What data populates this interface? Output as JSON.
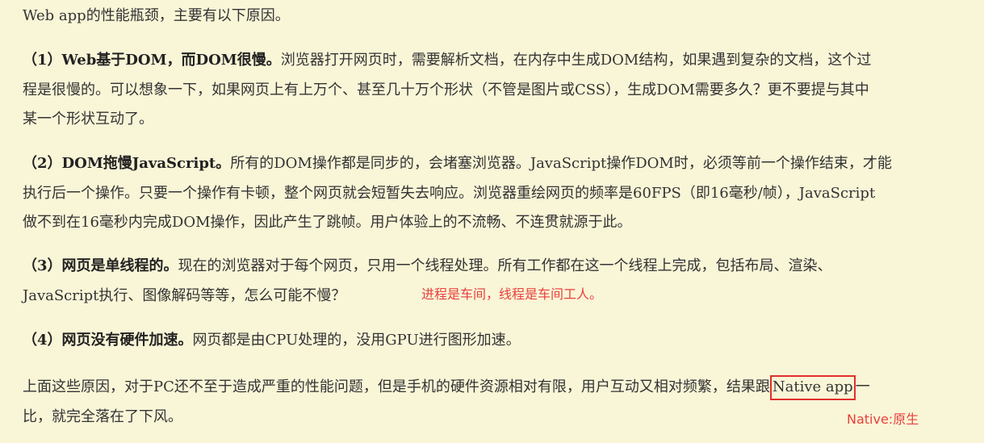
{
  "intro": "Web app的性能瓶颈，主要有以下原因。",
  "p1": {
    "heading": "（1）Web基于DOM，而DOM很慢。",
    "line1": "浏览器打开网页时，需要解析文档，在内存中生成DOM结构，如果遇到复杂的文档，这个过",
    "line2": "程是很慢的。可以想象一下，如果网页上有上万个、甚至几十万个形状（不管是图片或CSS），生成DOM需要多久？更不要提与其中",
    "line3": "某一个形状互动了。"
  },
  "p2": {
    "heading": "（2）DOM拖慢JavaScript。",
    "line1": "所有的DOM操作都是同步的，会堵塞浏览器。JavaScript操作DOM时，必须等前一个操作结束，才能",
    "line2": "执行后一个操作。只要一个操作有卡顿，整个网页就会短暂失去响应。浏览器重绘网页的频率是60FPS（即16毫秒/帧），JavaScript",
    "line3": "做不到在16毫秒内完成DOM操作，因此产生了跳帧。用户体验上的不流畅、不连贯就源于此。"
  },
  "p3": {
    "heading": "（3）网页是单线程的。",
    "line1": "现在的浏览器对于每个网页，只用一个线程处理。所有工作都在这一个线程上完成，包括布局、渲染、",
    "line2": "JavaScript执行、图像解码等等，怎么可能不慢？"
  },
  "p4": {
    "heading": "（4）网页没有硬件加速。",
    "line1": "网页都是由CPU处理的，没用GPU进行图形加速。"
  },
  "p5": {
    "line1_before": "上面这些原因，对于PC还不至于造成严重的性能问题，但是手机的硬件资源相对有限，用户互动又相对频繁，结果跟",
    "line1_boxed": "Native app",
    "line1_after": "一",
    "line2": "比，就完全落在了下风。"
  },
  "annotations": {
    "thread_note": "进程是车间，线程是车间工人。",
    "native_note": "Native:原生"
  },
  "colors": {
    "background": "#f9f5d7",
    "text": "#333333",
    "annotation": "#e8413b"
  }
}
